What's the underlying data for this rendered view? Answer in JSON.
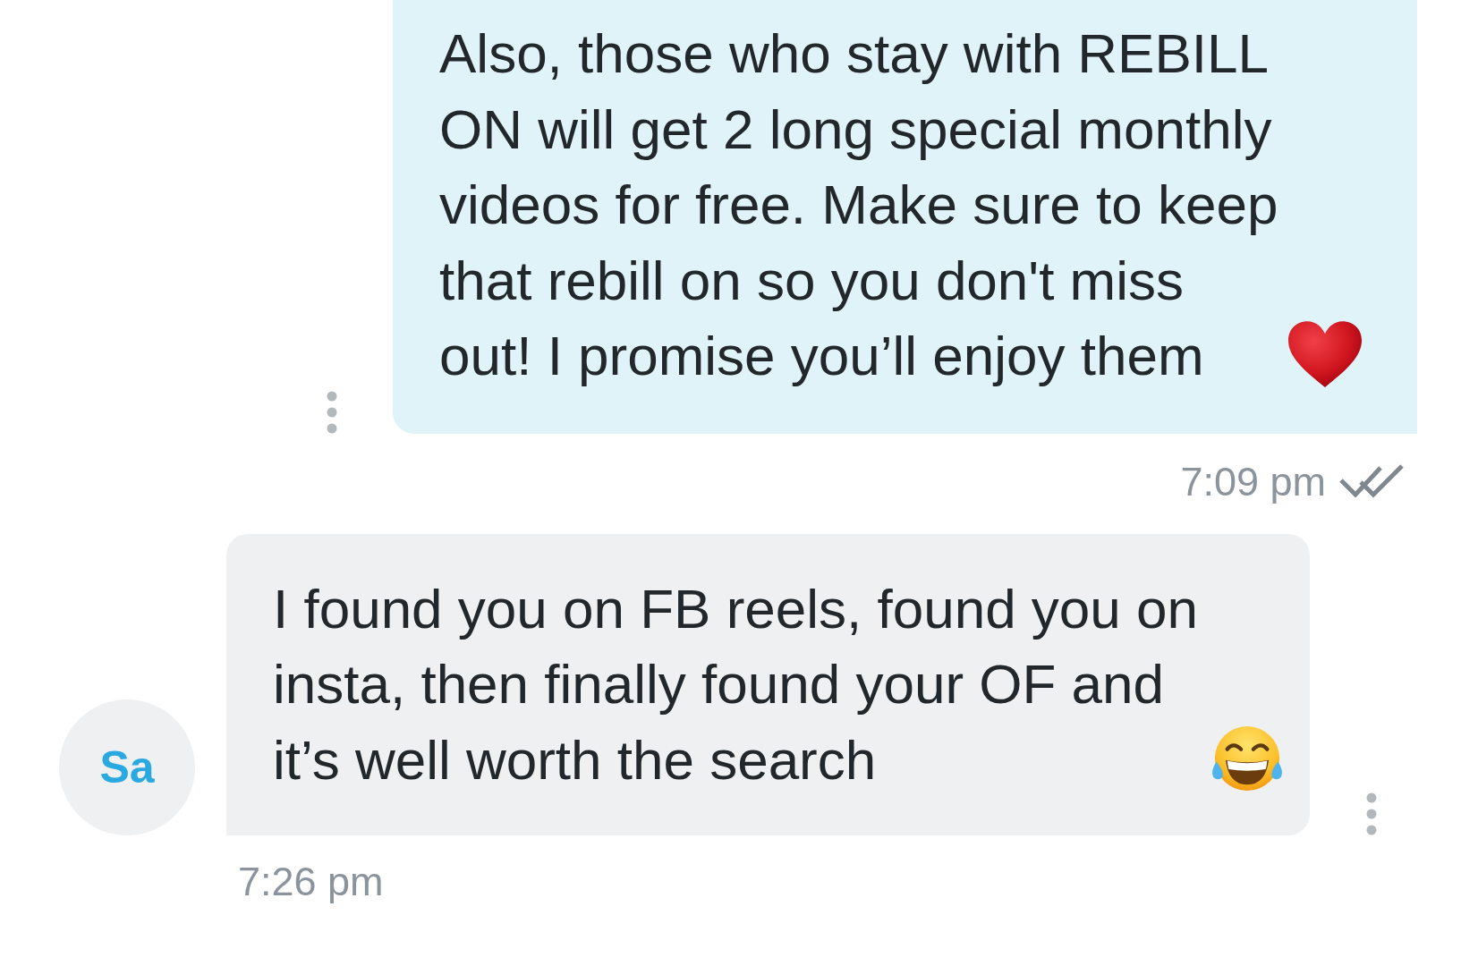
{
  "messages": [
    {
      "kind": "outgoing",
      "lines": [
        "Also, those who stay with REBILL",
        "ON will get 2 long special monthly",
        "videos for free. Make sure to keep",
        "that rebill on so you don't miss",
        "out! I promise you’ll enjoy them"
      ],
      "time": "7:09 pm",
      "read": true
    },
    {
      "kind": "incoming",
      "avatar": "Sa",
      "lines": [
        "I found you on FB reels, found you on",
        "insta, then finally found your OF and",
        "it’s well worth the search"
      ],
      "time": "7:26 pm"
    }
  ]
}
